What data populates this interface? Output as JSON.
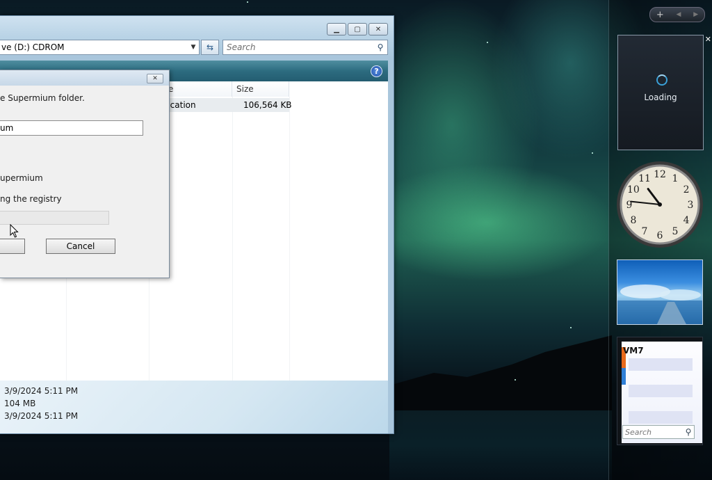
{
  "explorer": {
    "address_text": "ve (D:) CDROM",
    "search_placeholder": "Search",
    "columns": [
      {
        "label": "e"
      },
      {
        "label": "Size"
      }
    ],
    "file_row": {
      "type": "lication",
      "size": "106,564 KB"
    },
    "details": [
      "3/9/2024 5:11 PM",
      "104 MB",
      "3/9/2024 5:11 PM"
    ],
    "help_glyph": "?"
  },
  "dialog": {
    "instruction": "e Supermium folder.",
    "path_value": "um",
    "status_1": "upermium",
    "status_2": "ng the registry",
    "cancel_label": "Cancel",
    "close_glyph": "✕"
  },
  "sidebar": {
    "add_glyph": "+",
    "prev_glyph": "◀",
    "next_glyph": "▶",
    "close_glyph": "✕",
    "loading_text": "Loading",
    "clock_numbers": [
      "12",
      "1",
      "2",
      "3",
      "4",
      "5",
      "6",
      "7",
      "8",
      "9",
      "10",
      "11"
    ],
    "notes_title": "VM7",
    "notes_search_placeholder": "Search",
    "clock_time": "10:46"
  },
  "colors": {
    "toolbar": "#2d6c80",
    "accent_orange": "#e86a1c",
    "accent_blue": "#2f7fd6"
  },
  "icons": [
    "minimize-icon",
    "maximize-icon",
    "close-icon",
    "chevron-down-icon",
    "refresh-icon",
    "search-icon",
    "help-icon",
    "mouse-cursor-icon",
    "spinner-icon",
    "clock-icon"
  ]
}
